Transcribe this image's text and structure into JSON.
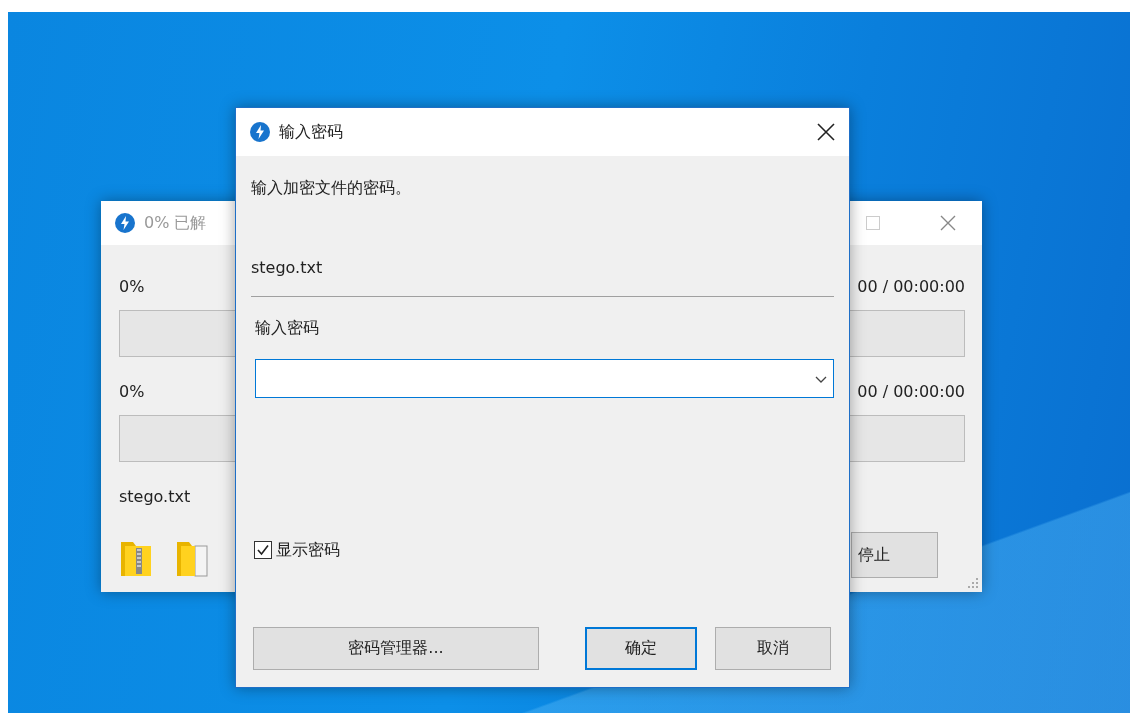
{
  "background_window": {
    "title": "0% 已解",
    "progress_rows": [
      {
        "percent": "0%",
        "time": "00 / 00:00:00",
        "level": 0
      },
      {
        "percent": "0%",
        "time": "00 / 00:00:00",
        "level": 0
      }
    ],
    "filename": "stego.txt",
    "stop_button": "停止"
  },
  "dialog": {
    "title": "输入密码",
    "message": "输入加密文件的密码。",
    "filename": "stego.txt",
    "password_label": "输入密码",
    "show_password": {
      "label": "显示密码",
      "checked": true
    },
    "buttons": [
      {
        "label": "密码管理器...",
        "default": false,
        "kind": "wide"
      },
      {
        "label": "确定",
        "default": true,
        "kind": "normal"
      },
      {
        "label": "取消",
        "default": false,
        "kind": "normal"
      }
    ]
  }
}
